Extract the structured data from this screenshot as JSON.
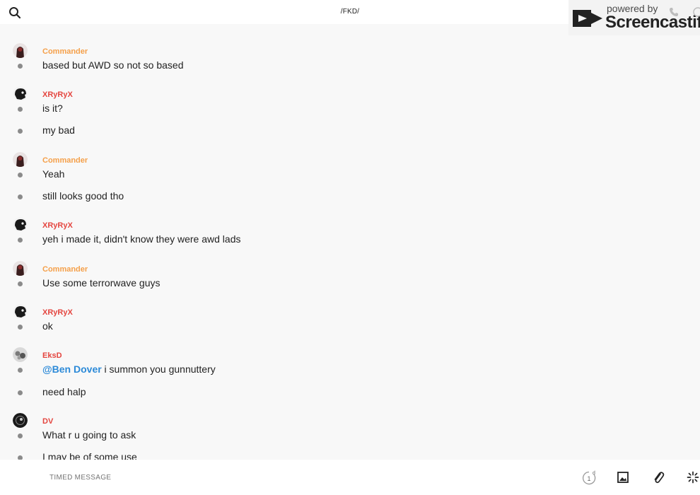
{
  "header": {
    "channel": "/FKD/",
    "search_icon": "search-icon"
  },
  "watermark": {
    "powered": "powered by",
    "brand": "Screencastify"
  },
  "colors": {
    "commander": "#f5a04a",
    "xryryx": "#e4453f",
    "eksd": "#e4453f",
    "dv": "#e4453f",
    "mention": "#2c8ad8"
  },
  "groups": [
    {
      "author": "Commander",
      "messages": [
        "based but AWD so not so based"
      ]
    },
    {
      "author": "XRyRyX",
      "messages": [
        "is it?",
        "my bad"
      ]
    },
    {
      "author": "Commander",
      "messages": [
        "Yeah",
        "still looks good tho"
      ]
    },
    {
      "author": "XRyRyX",
      "messages": [
        "yeh i made it, didn't know they were awd lads"
      ]
    },
    {
      "author": "Commander",
      "messages": [
        "Use some terrorwave guys"
      ]
    },
    {
      "author": "XRyRyX",
      "messages": [
        "ok"
      ]
    },
    {
      "author": "EksD",
      "mention": "@Ben Dover",
      "messages": [
        " i summon you gunnuttery",
        "need halp"
      ]
    },
    {
      "author": "DV",
      "messages": [
        "What r u going to ask",
        "I may be of some use"
      ]
    }
  ],
  "composer": {
    "placeholder": "TIMED MESSAGE",
    "timer_value": "1",
    "timer_unit": "d"
  }
}
